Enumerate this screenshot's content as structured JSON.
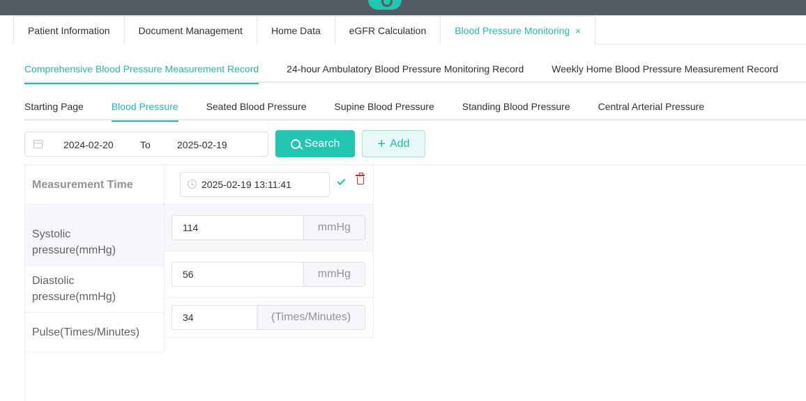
{
  "tabs": [
    {
      "label": "Patient Information"
    },
    {
      "label": "Document Management"
    },
    {
      "label": "Home Data"
    },
    {
      "label": "eGFR Calculation"
    },
    {
      "label": "Blood Pressure Monitoring",
      "close": "×"
    }
  ],
  "record_tabs": [
    {
      "label": "Comprehensive Blood Pressure Measurement Record"
    },
    {
      "label": "24-hour Ambulatory Blood Pressure Monitoring Record"
    },
    {
      "label": "Weekly Home Blood Pressure Measurement Record"
    }
  ],
  "type_tabs": [
    {
      "label": "Starting Page"
    },
    {
      "label": "Blood Pressure"
    },
    {
      "label": "Seated Blood Pressure"
    },
    {
      "label": "Supine Blood Pressure"
    },
    {
      "label": "Standing Blood Pressure"
    },
    {
      "label": "Central Arterial Pressure"
    }
  ],
  "filter": {
    "start_date": "2024-02-20",
    "to_label": "To",
    "end_date": "2025-02-19",
    "search_label": "Search",
    "add_label": "Add"
  },
  "record": {
    "measurement_time_label": "Measurement Time",
    "measurement_time": "2025-02-19 13:11:41",
    "systolic_label": "Systolic pressure(mmHg)",
    "systolic_value": "114",
    "systolic_unit": "mmHg",
    "diastolic_label": "Diastolic pressure(mmHg)",
    "diastolic_value": "56",
    "diastolic_unit": "mmHg",
    "pulse_label": "Pulse(Times/Minutes)",
    "pulse_value": "34",
    "pulse_unit": "(Times/Minutes)"
  },
  "colors": {
    "accent": "#22b9ab",
    "topbar": "#545c64",
    "delete": "#e02020"
  }
}
